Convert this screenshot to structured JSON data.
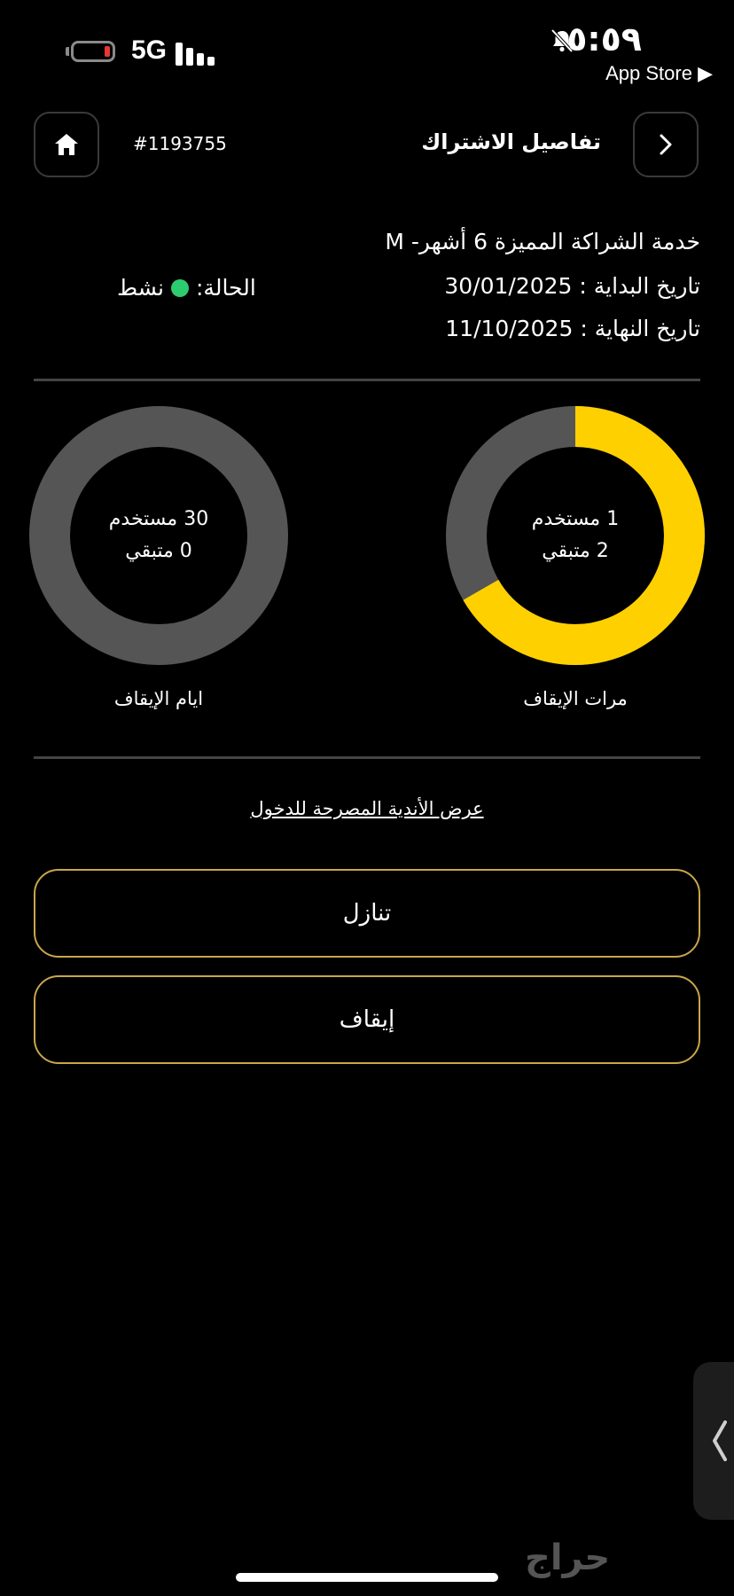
{
  "status_bar": {
    "network": "5G",
    "time": "٥:٥٩",
    "back_to_app": "App Store ▶"
  },
  "header": {
    "title": "تفاصيل الاشتراك",
    "subscription_id": "#1193755",
    "home_icon": "home-icon",
    "back_icon": "chevron-right-icon"
  },
  "subscription": {
    "service_name": "خدمة الشراكة المميزة 6 أشهر- M",
    "start_date": "تاريخ البداية : 30/01/2025",
    "end_date": "تاريخ النهاية : 11/10/2025",
    "status_label": "الحالة:",
    "status_value": "نشط",
    "status_color": "#2ecc71"
  },
  "freeze_times": {
    "used_text": "1 مستخدم",
    "remaining_text": "2 متبقي",
    "used": 1,
    "remaining": 2,
    "label": "مرات الإيقاف",
    "used_color": "#555555",
    "remaining_color": "#ffd000"
  },
  "freeze_days": {
    "used_text": "30 مستخدم",
    "remaining_text": "0 متبقي",
    "used": 30,
    "remaining": 0,
    "label": "ايام الإيقاف",
    "used_color": "#555555",
    "remaining_color": "#ffd000"
  },
  "links": {
    "allowed_clubs": "عرض الأندية المصرحة للدخول"
  },
  "actions": {
    "transfer": "تنازل",
    "freeze": "إيقاف"
  },
  "watermark": "حراج",
  "accent_color": "#c9a64a"
}
